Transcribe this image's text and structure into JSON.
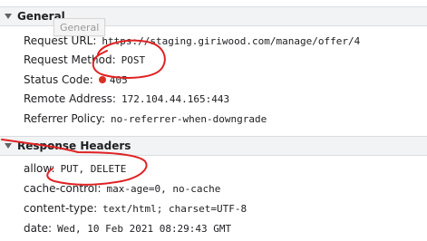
{
  "general": {
    "title": "General",
    "tooltip": "General",
    "rows": [
      {
        "label": "Request URL:",
        "value": "https://staging.giriwood.com/manage/offer/4"
      },
      {
        "label": "Request Method:",
        "value": "POST"
      },
      {
        "label": "Status Code:",
        "value": "405",
        "status_color": "#d93025"
      },
      {
        "label": "Remote Address:",
        "value": "172.104.44.165:443"
      },
      {
        "label": "Referrer Policy:",
        "value": "no-referrer-when-downgrade"
      }
    ]
  },
  "response_headers": {
    "title": "Response Headers",
    "rows": [
      {
        "label": "allow:",
        "value": "PUT, DELETE"
      },
      {
        "label": "cache-control:",
        "value": "max-age=0, no-cache"
      },
      {
        "label": "content-type:",
        "value": "text/html; charset=UTF-8"
      },
      {
        "label": "date:",
        "value": "Wed, 10 Feb 2021 08:29:43 GMT"
      }
    ]
  },
  "icons": {
    "collapse": "triangle-down-icon",
    "status": "status-error-dot"
  },
  "colors": {
    "annotation": "#e02222",
    "header_bg": "#f1f3f4"
  }
}
